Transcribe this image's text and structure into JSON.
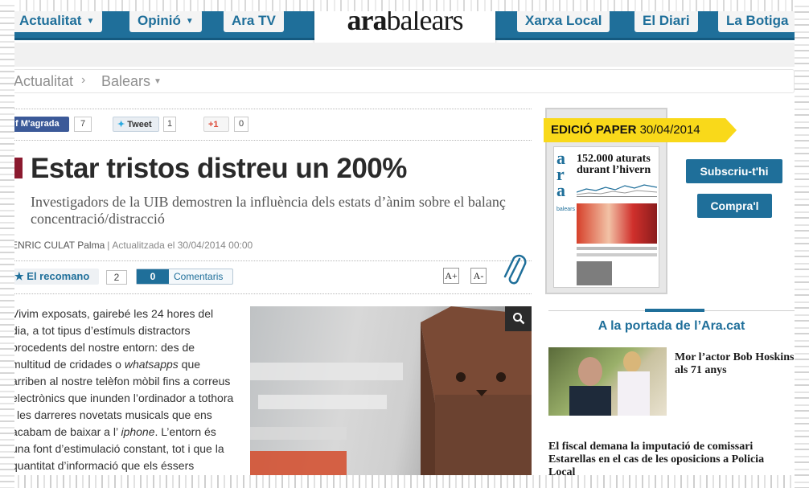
{
  "nav": {
    "items": [
      {
        "label": "Actualitat",
        "dropdown": true
      },
      {
        "label": "Opinió",
        "dropdown": true
      },
      {
        "label": "Ara TV",
        "dropdown": false
      },
      {
        "label": "Xarxa Local",
        "dropdown": false
      },
      {
        "label": "El Diari",
        "dropdown": false
      },
      {
        "label": "La Botiga",
        "dropdown": false
      }
    ],
    "logo": {
      "part1": "ara",
      "part2": "balears"
    }
  },
  "breadcrumb": {
    "item1": "Actualitat",
    "item2": "Balears"
  },
  "share": {
    "facebook": {
      "label": "M'agrada",
      "count": "7"
    },
    "twitter": {
      "label": "Tweet",
      "count": "1"
    },
    "gplus": {
      "label": "+1",
      "count": "0"
    }
  },
  "article": {
    "headline": "Estar tristos distreu un 200%",
    "subheadline": "Investigadors de la UIB demostren la influència dels estats d’ànim sobre el balanç concentració/distracció",
    "author": "ENRIC CULAT Palma",
    "updated": "Actualitzada el 30/04/2014 00:00",
    "recommend_label": "El recomano",
    "recommend_count": "2",
    "comments_count": "0",
    "comments_label": "Comentaris",
    "font_increase": "A+",
    "font_decrease": "A-",
    "body": [
      "Vivim exposats, gairebé les 24 hores del",
      "dia, a tot tipus d’estímuls distractors",
      "procedents del nostre entorn: des de",
      "multitud de cridades o ",
      "whatsapps",
      " que",
      "arriben al nostre telèfon mòbil fins a correus",
      "electrònics que inunden l’ordinador a tothora",
      "i les darreres novetats musicals que ens",
      "acabam de baixar a l’ ",
      "iphone",
      ". L’entorn és",
      "una font d’estimulació constant, tot i que la",
      "quantitat d’informació que els éssers"
    ]
  },
  "sidebar": {
    "paper_label": "EDICIÓ PAPER",
    "paper_date": "30/04/2014",
    "cover_brand_1": "a",
    "cover_brand_2": "r",
    "cover_brand_3": "a",
    "cover_brand_small": "balears",
    "cover_headline": "152.000 aturats durant l’hivern",
    "subscribe_label": "Subscriu-t'hi",
    "buy_label": "Compra'l",
    "portada_title": "A la portada de l’Ara.cat",
    "news": [
      {
        "title": "Mor l’actor Bob Hoskins als 71 anys"
      },
      {
        "title": "El fiscal demana la imputació de comissari Estarellas en el cas de les oposicions a Policia Local"
      }
    ]
  },
  "colors": {
    "brand_blue": "#1f6f9a",
    "banner_yellow": "#f9d91a",
    "facebook_blue": "#3b5998"
  }
}
